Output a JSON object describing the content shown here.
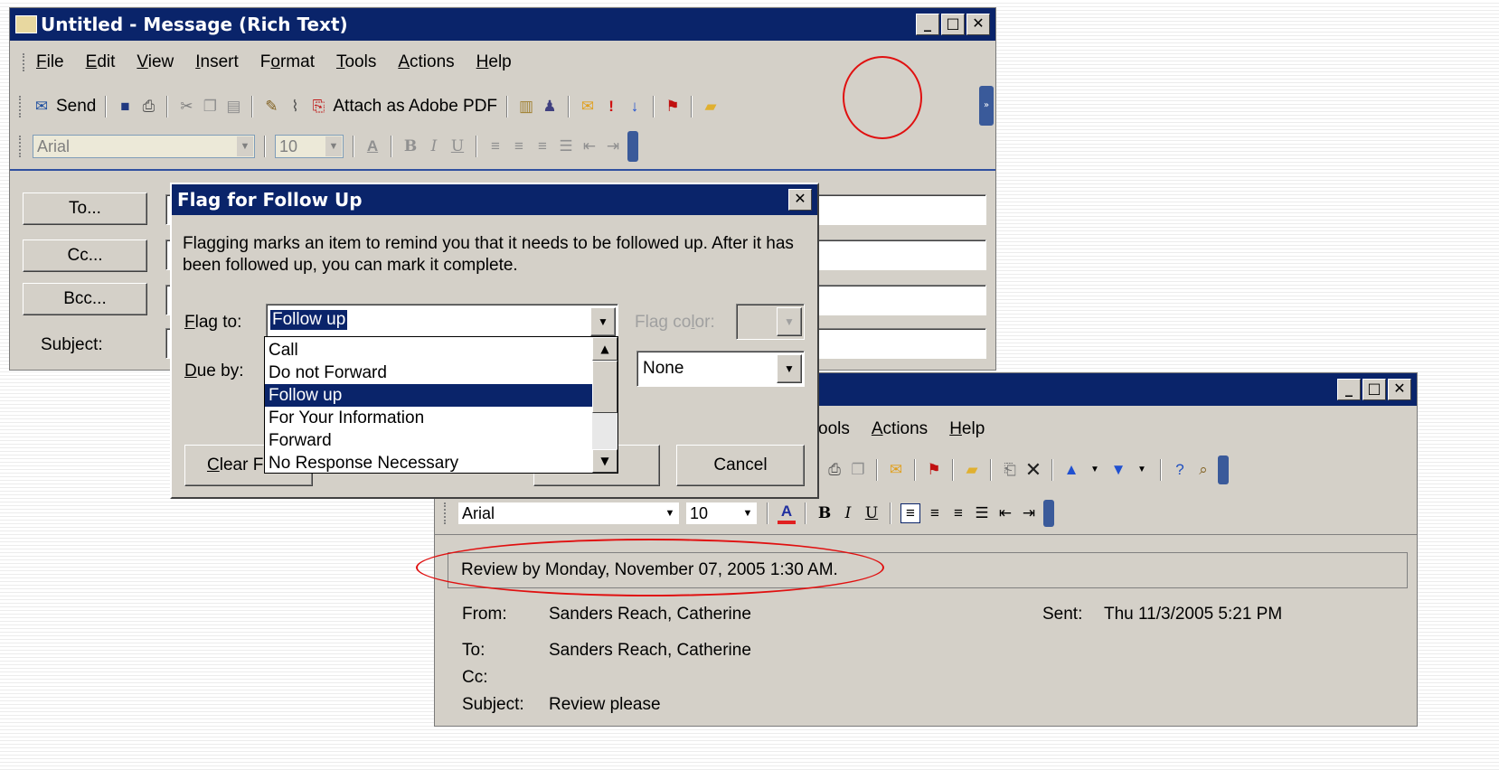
{
  "compose_window": {
    "title": "Untitled - Message (Rich Text)",
    "menu": [
      "File",
      "Edit",
      "View",
      "Insert",
      "Format",
      "Tools",
      "Actions",
      "Help"
    ],
    "menu_keys": [
      "F",
      "E",
      "V",
      "I",
      "o",
      "T",
      "A",
      "H"
    ],
    "toolbar": {
      "send_label": "Send",
      "attach_pdf_label": "Attach as Adobe PDF"
    },
    "format_toolbar": {
      "font": "Arial",
      "size": "10"
    },
    "address_buttons": {
      "to": "To...",
      "cc": "Cc...",
      "bcc": "Bcc..."
    },
    "subject_label": "Subject:"
  },
  "flag_dialog": {
    "title": "Flag for Follow Up",
    "description": "Flagging marks an item to remind you that it needs to be followed up.  After it has been followed up, you can mark it complete.",
    "flag_to_label": "Flag to:",
    "flag_to_value": "Follow up",
    "flag_color_label": "Flag color:",
    "due_by_label": "Due by:",
    "due_time_value": "None",
    "dropdown_options": [
      "Call",
      "Do not Forward",
      "Follow up",
      "For Your Information",
      "Forward",
      "No Response Necessary"
    ],
    "selected_option": "Follow up",
    "clear_flag_label": "Clear Flag",
    "cancel_label": "Cancel"
  },
  "read_window": {
    "menu_visible": [
      "ools",
      "Actions",
      "Help"
    ],
    "format_toolbar": {
      "font": "Arial",
      "size": "10"
    },
    "info_bar": "Review by Monday, November 07, 2005 1:30 AM.",
    "header": {
      "from_label": "From:",
      "from_value": "Sanders Reach, Catherine",
      "sent_label": "Sent:",
      "sent_value": "Thu 11/3/2005 5:21 PM",
      "to_label": "To:",
      "to_value": "Sanders Reach, Catherine",
      "cc_label": "Cc:",
      "cc_value": "",
      "subject_label": "Subject:",
      "subject_value": "Review please"
    }
  },
  "colors": {
    "title_bar": "#0a246a",
    "window_face": "#d4d0c8",
    "annotation_circle": "#e01010"
  }
}
